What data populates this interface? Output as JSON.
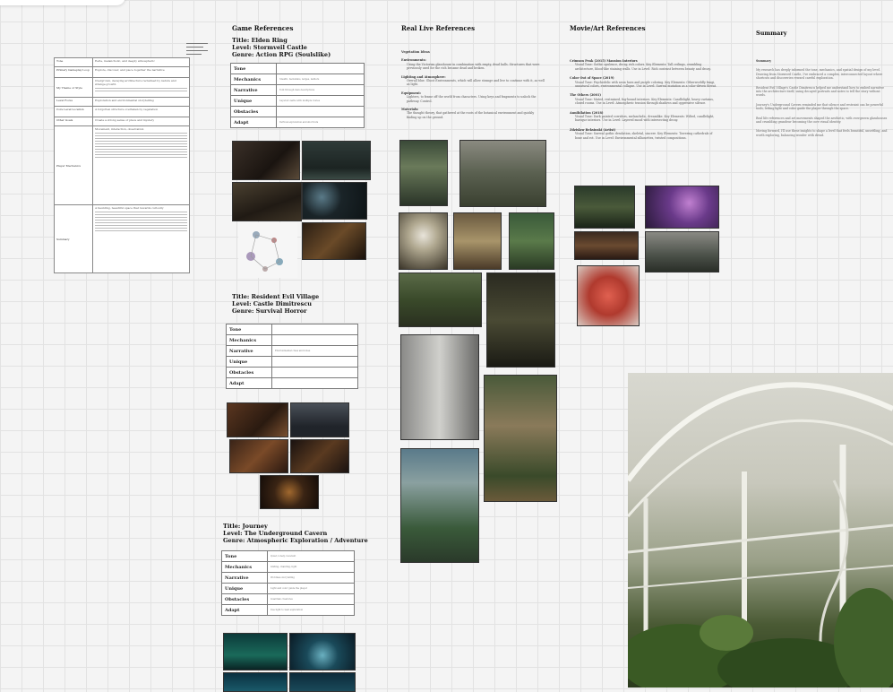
{
  "board": {
    "columns": {
      "game_refs": "Game References",
      "real_life": "Real Live References",
      "movie_art": "Movie/Art References",
      "summary": "Summary"
    }
  },
  "summary_table": {
    "rows": [
      {
        "k": "Tone",
        "v": "Eerie, melancholic, and deeply atmospheric"
      },
      {
        "k": "Primary Gameplay Loop",
        "v": "Explore, discover, and piece together the narrative"
      },
      {
        "k": "My Theme or Style",
        "v": "Overgrown, decaying architecture reclaimed by nature and strange growth"
      },
      {
        "k": "Level Focus",
        "v": "Exploration and environmental storytelling"
      },
      {
        "k": "Core Level Location",
        "v": "A forgotten structure overtaken by vegetation"
      },
      {
        "k": "Other Goals",
        "v": "Create a strong sense of place and mystery"
      },
      {
        "k": "Player Mechanics",
        "v": "Movement, interaction, observation"
      },
      {
        "k": "Summary",
        "v": "A haunting, beautiful space that rewards curiosity"
      }
    ]
  },
  "games": [
    {
      "title": "Title: Elden Ring",
      "level": "Level: Stormveil Castle",
      "genre": "Genre: Action RPG (Soulslike)",
      "rows": [
        {
          "k": "Tone",
          "v": ""
        },
        {
          "k": "Mechanics",
          "v": "Stealth, backstabs, ledges, ladders"
        },
        {
          "k": "Narrative",
          "v": "Told through item descriptions"
        },
        {
          "k": "Unique",
          "v": "Layered castle with multiple routes"
        },
        {
          "k": "Obstacles",
          "v": ""
        },
        {
          "k": "Adapt",
          "v": "Vertical exploration and shortcuts"
        }
      ]
    },
    {
      "title": "Title: Resident Evil Village",
      "level": "Level: Castle Dimitrescu",
      "genre": "Genre: Survival Horror",
      "rows": [
        {
          "k": "Tone",
          "v": ""
        },
        {
          "k": "Mechanics",
          "v": ""
        },
        {
          "k": "Narrative",
          "v": "Environmental clues and notes"
        },
        {
          "k": "Unique",
          "v": ""
        },
        {
          "k": "Obstacles",
          "v": ""
        },
        {
          "k": "Adapt",
          "v": ""
        }
      ]
    },
    {
      "title": "Title: Journey",
      "level": "Level: The Underground Cavern",
      "genre": "Genre: Atmospheric Exploration / Adventure",
      "rows": [
        {
          "k": "Tone",
          "v": "Quiet, lonely, reverent"
        },
        {
          "k": "Mechanics",
          "v": "Gliding, chanting, light"
        },
        {
          "k": "Narrative",
          "v": "Wordless storytelling"
        },
        {
          "k": "Unique",
          "v": "Light and color guide the player"
        },
        {
          "k": "Obstacles",
          "v": "Guardian creatures"
        },
        {
          "k": "Adapt",
          "v": "Use light to lead exploration"
        }
      ]
    }
  ],
  "real_life_notes": [
    {
      "h": "Vegetation Ideas",
      "t": ""
    },
    {
      "h": "Environments:",
      "t": "Using the Victorian glasshouse in combination with empty, dead halls. Structures that were previously used for the rich became dead and broken."
    },
    {
      "h": "Lighting and Atmosphere:",
      "t": "Overall blue. Ghost Environments, which will allow strange and live to continue with it, as well as light."
    },
    {
      "h": "Equipment:",
      "t": "Lighters, to frame off the world from characters. Using keys and fragments to unlock the pathway. Control."
    },
    {
      "h": "Materials:",
      "t": "The thought theory, that gathered at the roots of the botanical environment and quickly finding up on the ground."
    }
  ],
  "movie_notes": [
    {
      "h": "Crimson Peak (2015) Mansion Interiors",
      "t": "Visual Tone: Gothic opulence, decay, rich colors. Key Elements: Tall ceilings, crumbling architecture, blood-like staining walls. Use in Level: Rich contrast between beauty and decay."
    },
    {
      "h": "Color Out of Space (2019)",
      "t": "Visual Tone: Psychedelic with neon hues and purple coloring. Key Elements: Otherworldly fungi, unnatural colors, environmental collapse. Use in Level: Surreal mutation as a color-driven threat."
    },
    {
      "h": "The Others (2001)",
      "t": "Visual Tone: Muted, restrained, fog-bound interiors. Key Elements: Candlelight, heavy curtains, closed rooms. Use in Level: Atmospheric tension through shadows and oppressive silence."
    },
    {
      "h": "Annihilation (2018)",
      "t": "Visual Tone: Dark painted corridors, melancholic, dreamlike. Key Elements: Wilted, candlelight, baroque interiors. Use in Level: Layered mood with intersecting decay."
    },
    {
      "h": "Zdzislaw Beksinski (Artist)",
      "t": "Visual Tone: Surreal gothic desolation, skeletal, sincere. Key Elements: Towering cathedrals of bone and rot. Use in Level: Environmental silhouettes, twisted compositions."
    }
  ],
  "summary_paragraphs": [
    "Summary",
    "My research has deeply informed the tone, mechanics, and spatial design of my level. Drawing from Stormveil Castle, I've embraced a complex, interconnected layout where shortcuts and discoveries reward careful exploration.",
    "Resident Evil Village's Castle Dimitrescu helped me understand how to embed narrative into the architecture itself, using decayed portraits and notes to tell the story without words.",
    "Journey's Underground Cavern reminded me that silence and restraint can be powerful tools, letting light and color guide the player through the space.",
    "Real life references and art movements shaped the aesthetic, with overgrown glasshouses and crumbling grandeur becoming the core visual identity.",
    "Moving forward, I'll use these insights to shape a level that feels beautiful, unsettling, and worth exploring, balancing wonder with dread."
  ]
}
